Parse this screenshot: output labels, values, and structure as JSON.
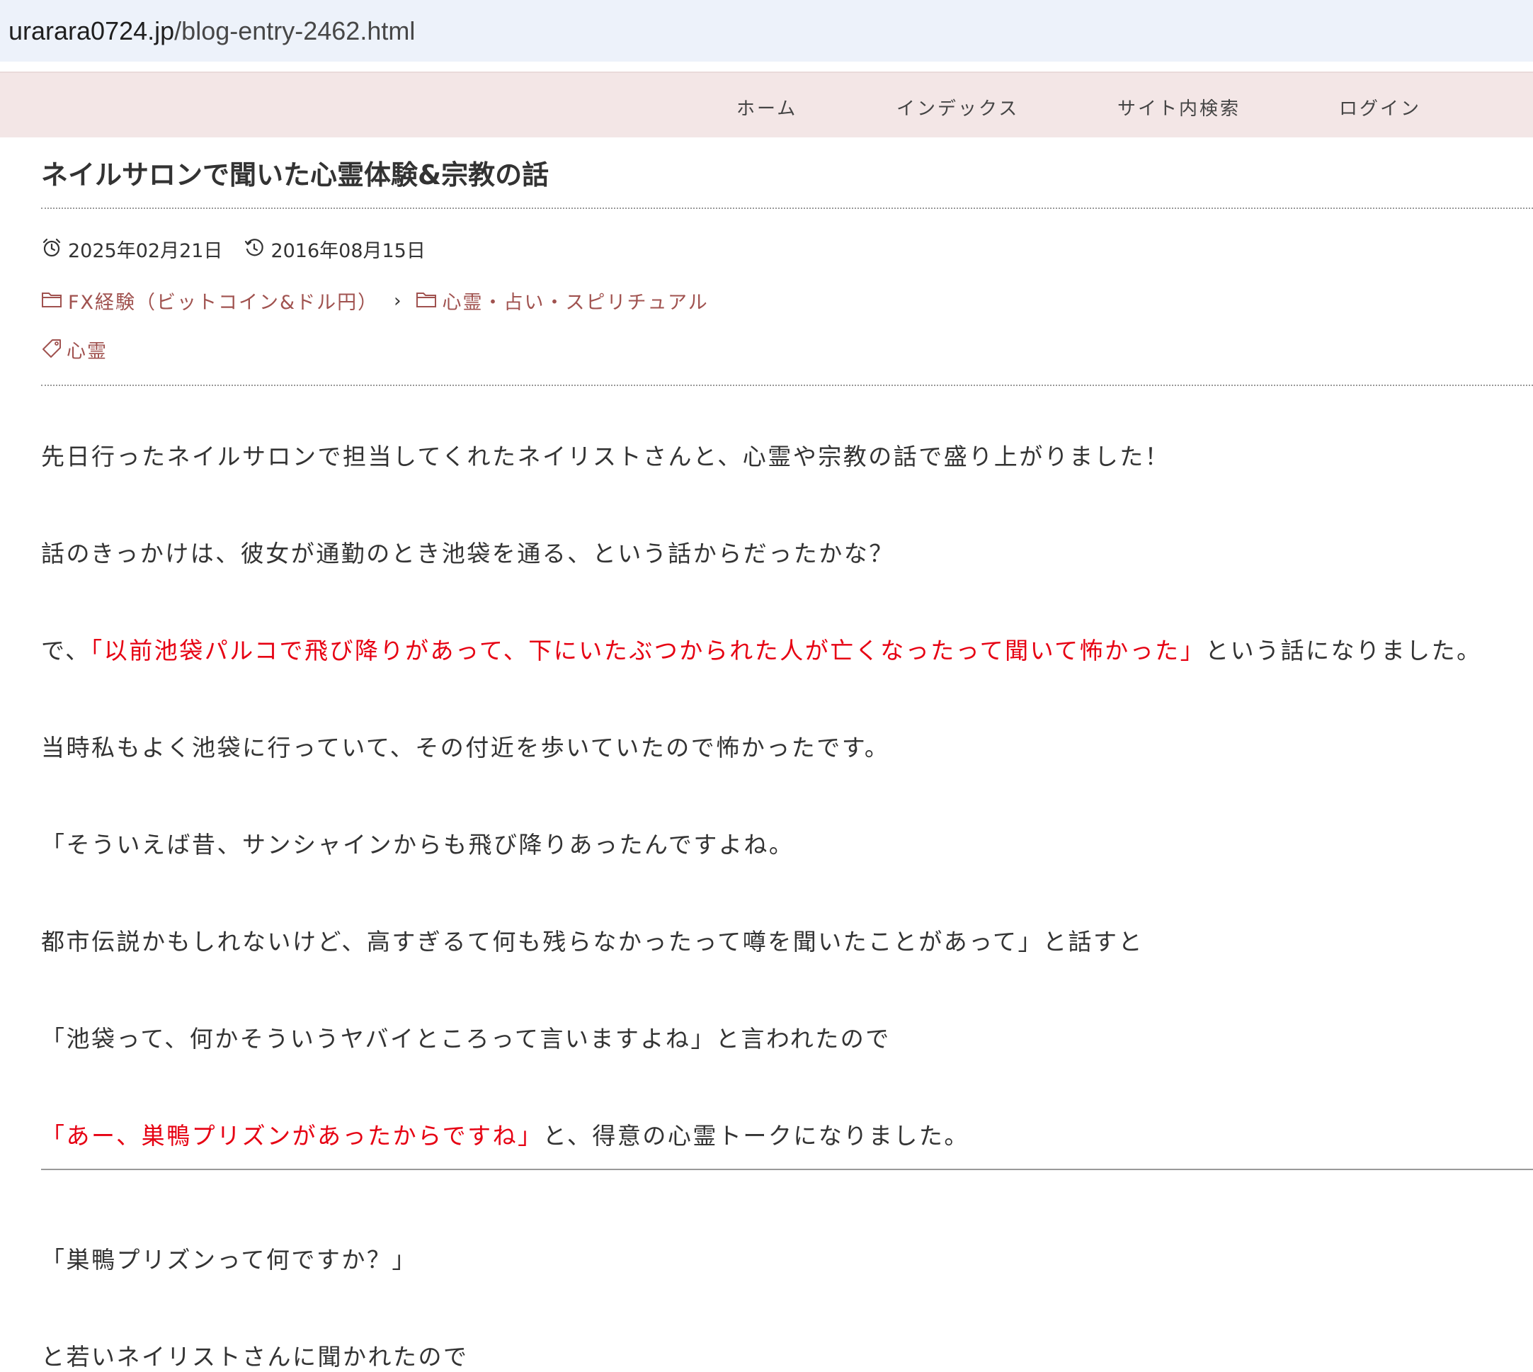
{
  "browser": {
    "url_domain": "urarara0724.jp",
    "url_path": "/blog-entry-2462.html"
  },
  "nav": {
    "items": [
      "ホーム",
      "インデックス",
      "サイト内検索",
      "ログイン"
    ]
  },
  "article": {
    "title": "ネイルサロンで聞いた心霊体験&宗教の話",
    "posted_date": "2025年02月21日",
    "updated_date": "2016年08月15日",
    "categories": [
      "FX経験（ビットコイン&ドル円）",
      "心霊・占い・スピリチュアル"
    ],
    "tag": "心霊",
    "paragraphs": [
      {
        "text": "先日行ったネイルサロンで担当してくれたネイリストさんと、心霊や宗教の話で盛り上がりました！"
      },
      {
        "text": "話のきっかけは、彼女が通勤のとき池袋を通る、という話からだったかな？"
      },
      {
        "before": "で、",
        "red": "「以前池袋パルコで飛び降りがあって、下にいたぶつかられた人が亡くなったって聞いて怖かった」",
        "after": "という話になりました。"
      },
      {
        "text": "当時私もよく池袋に行っていて、その付近を歩いていたので怖かったです。"
      },
      {
        "text": "「そういえば昔、サンシャインからも飛び降りあったんですよね。"
      },
      {
        "text": "都市伝説かもしれないけど、高すぎるて何も残らなかったって噂を聞いたことがあって」と話すと"
      },
      {
        "text": "「池袋って、何かそういうヤバイところって言いますよね」と言われたので"
      },
      {
        "red": "「あー、巣鴨プリズンがあったからですね」",
        "after": "と、得意の心霊トークになりました。"
      },
      {
        "text": "「巣鴨プリズンって何ですか？」"
      },
      {
        "text": "と若いネイリストさんに聞かれたので"
      }
    ]
  },
  "colors": {
    "link": "#a0524f",
    "emphasis": "#e60012",
    "nav_bg": "#f3e6e6",
    "urlbar_bg": "#edf2fa"
  }
}
